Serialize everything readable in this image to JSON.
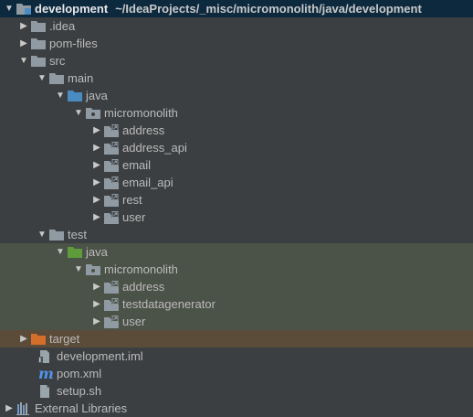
{
  "root": {
    "name": "development",
    "path": "~/IdeaProjects/_misc/micromonolith/java/development",
    "expanded": true
  },
  "nodes": {
    "idea": {
      "label": ".idea",
      "icon": "folder-icon"
    },
    "pom_files": {
      "label": "pom-files",
      "icon": "folder-icon"
    },
    "src": {
      "label": "src",
      "icon": "folder-icon"
    },
    "main": {
      "label": "main",
      "icon": "folder-icon"
    },
    "main_java": {
      "label": "java",
      "icon": "source-root-folder-icon"
    },
    "main_pkg": {
      "label": "micromonolith",
      "icon": "package-icon"
    },
    "main_address": {
      "label": "address",
      "icon": "module-package-icon"
    },
    "main_address_api": {
      "label": "address_api",
      "icon": "module-package-icon"
    },
    "main_email": {
      "label": "email",
      "icon": "module-package-icon"
    },
    "main_email_api": {
      "label": "email_api",
      "icon": "module-package-icon"
    },
    "main_rest": {
      "label": "rest",
      "icon": "module-package-icon"
    },
    "main_user": {
      "label": "user",
      "icon": "module-package-icon"
    },
    "test": {
      "label": "test",
      "icon": "folder-icon"
    },
    "test_java": {
      "label": "java",
      "icon": "test-root-folder-icon"
    },
    "test_pkg": {
      "label": "micromonolith",
      "icon": "package-icon"
    },
    "test_address": {
      "label": "address",
      "icon": "module-package-icon"
    },
    "test_datagen": {
      "label": "testdatagenerator",
      "icon": "module-package-icon"
    },
    "test_user": {
      "label": "user",
      "icon": "module-package-icon"
    },
    "target": {
      "label": "target",
      "icon": "excluded-folder-icon"
    },
    "iml": {
      "label": "development.iml",
      "icon": "iml-file-icon"
    },
    "pom": {
      "label": "pom.xml",
      "icon": "maven-m-icon"
    },
    "setup": {
      "label": "setup.sh",
      "icon": "shell-file-icon"
    },
    "ext_libs": {
      "label": "External Libraries",
      "icon": "libraries-icon"
    }
  },
  "glyphs": {
    "collapsed": "▶",
    "expanded": "▼",
    "maven_m": "m"
  },
  "colors": {
    "background": "#3c3f41",
    "selected_row": "#0d293e",
    "test_band": "#4b5247",
    "excluded_band": "#5b4b39",
    "folder": "#8f9aa3",
    "source_root": "#4a8bc2",
    "test_root": "#5f9b3a",
    "excluded": "#d36e2b",
    "maven": "#5394ec",
    "text": "#bbbbbb"
  }
}
